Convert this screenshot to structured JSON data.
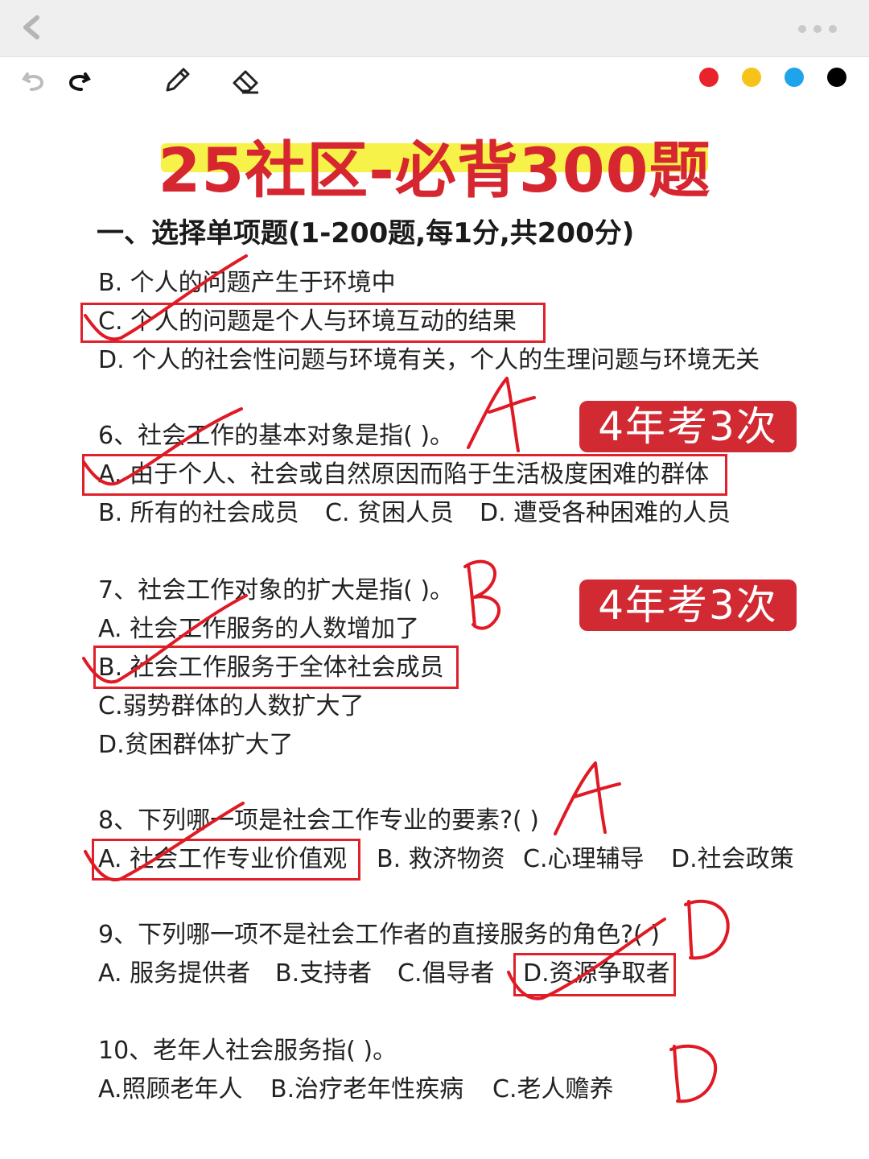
{
  "title": "25社区-必背300题",
  "section_heading": "一、选择单项题(1-200题,每1分,共200分)",
  "badges": [
    "4年考3次",
    "4年考3次"
  ],
  "handwritten_answers": [
    "A",
    "B",
    "A",
    "D",
    "D"
  ],
  "colors": {
    "accent": "#d6262f",
    "highlight": "#f6f24a",
    "swatch_red": "#e8232b",
    "swatch_yellow": "#f7c21a",
    "swatch_blue": "#1fa3ea",
    "swatch_black": "#000000"
  },
  "questions": {
    "q5": {
      "b": "B. 个人的问题产生于环境中",
      "c": "C. 个人的问题是个人与环境互动的结果",
      "d": "D. 个人的社会性问题与环境有关，个人的生理问题与环境无关"
    },
    "q6": {
      "stem": "6、社会工作的基本对象是指( )。",
      "a": "A. 由于个人、社会或自然原因而陷于生活极度困难的群体",
      "b": "B. 所有的社会成员",
      "c": "C. 贫困人员",
      "d": "D. 遭受各种困难的人员"
    },
    "q7": {
      "stem": "7、社会工作对象的扩大是指( )。",
      "a": "A. 社会工作服务的人数增加了",
      "b": "B. 社会工作服务于全体社会成员",
      "c": "C.弱势群体的人数扩大了",
      "d": "D.贫困群体扩大了"
    },
    "q8": {
      "stem": "8、下列哪一项是社会工作专业的要素?( )",
      "a": "A. 社会工作专业价值观",
      "b": "B. 救济物资",
      "c": "C.心理辅导",
      "d": "D.社会政策"
    },
    "q9": {
      "stem": "9、下列哪一项不是社会工作者的直接服务的角色?( )",
      "a": "A. 服务提供者",
      "b": "B.支持者",
      "c": "C.倡导者",
      "d": "D.资源争取者"
    },
    "q10": {
      "stem": "10、老年人社会服务指( )。",
      "a": "A.照顾老年人",
      "b": "B.治疗老年性疾病",
      "c": "C.老人赡养"
    }
  }
}
